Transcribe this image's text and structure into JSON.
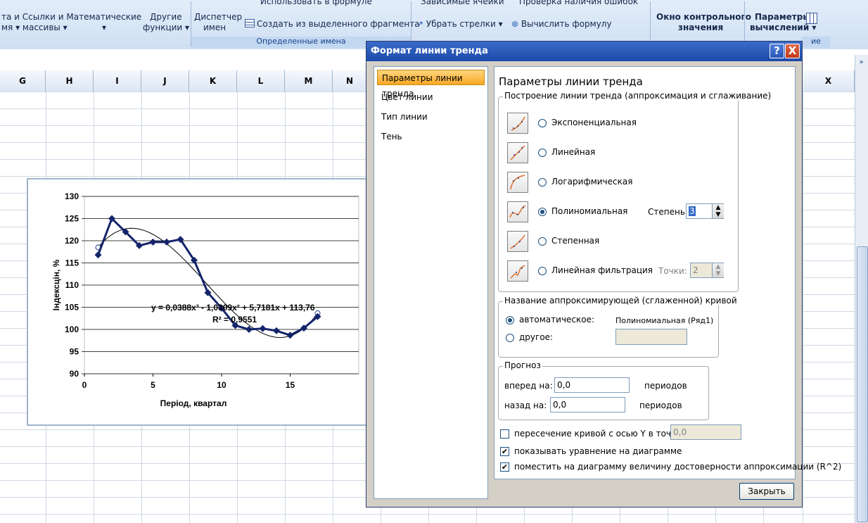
{
  "ribbon": {
    "items": {
      "r1": "та и  Ссылки и  Математические",
      "r1b": "мя ▾ массивы ▾",
      "r1c": "▾",
      "other": "Другие",
      "other2": "функции ▾",
      "dispatcher": "Диспетчер",
      "dispatcher2": "имен",
      "use_in_formula": "Использовать в формуле",
      "create_from_sel": "Создать из выделенного фрагмента",
      "dependent": "Зависимые ячейки",
      "check_errors": "Проверка наличия ошибок",
      "remove_arrows": "Убрать стрелки ▾",
      "eval_formula": "Вычислить формулу",
      "watch_window": "Окно контрольного",
      "watch_window2": "значения",
      "calc_params": "Параметры",
      "calc_params2": "вычислений ▾",
      "group_defined": "Определенные имена",
      "group_calc": "ие"
    }
  },
  "grid": {
    "columns": [
      "G",
      "H",
      "I",
      "J",
      "K",
      "L",
      "M",
      "N",
      "X"
    ]
  },
  "chart_data": {
    "type": "line",
    "title": "",
    "xlabel": "Період, квартал",
    "ylabel": "Індексцін, %",
    "xlim": [
      0,
      20
    ],
    "ylim": [
      90,
      130
    ],
    "xticks": [
      "0",
      "5",
      "10",
      "15"
    ],
    "yticks": [
      "90",
      "95",
      "100",
      "105",
      "110",
      "115",
      "120",
      "125",
      "130"
    ],
    "series": [
      {
        "x": [
          1,
          2,
          3,
          4,
          5,
          6,
          7,
          8,
          9,
          10,
          11,
          12,
          13,
          14,
          15,
          16,
          17
        ],
        "y": [
          116.8,
          125.0,
          122.0,
          118.9,
          119.7,
          119.7,
          120.3,
          115.6,
          108.3,
          104.8,
          100.9,
          100.0,
          100.2,
          99.7,
          98.7,
          100.3,
          102.9
        ]
      }
    ],
    "trendline": {
      "type": "polynomial",
      "order": 3,
      "coefficients": [
        0.0388,
        -1.0309,
        5.7181,
        113.76
      ]
    },
    "equation": "y = 0,0388x³ - 1,0309x² + 5,7181x + 113,76",
    "r_squared": "R² = 0,9551"
  },
  "dialog": {
    "title": "Формат линии тренда",
    "help": "?",
    "close_x": "X",
    "nav": [
      "Параметры линии тренда",
      "Цвет линии",
      "Тип линии",
      "Тень"
    ],
    "heading": "Параметры линии тренда",
    "group_build": "Построение линии тренда (аппроксимация и сглаживание)",
    "types": [
      "Экспоненциальная",
      "Линейная",
      "Логарифмическая",
      "Полиномиальная",
      "Степенная",
      "Линейная фильтрация"
    ],
    "degree_label": "Степень:",
    "degree_value": "3",
    "points_label": "Точки:",
    "points_value": "2",
    "group_name": "Название аппроксимирующей (сглаженной) кривой",
    "auto_label": "автоматическое:",
    "auto_value": "Полиномиальная (Ряд1)",
    "other_label": "другое:",
    "group_forecast": "Прогноз",
    "forward_label": "вперед на:",
    "forward_value": "0,0",
    "back_label": "назад на:",
    "back_value": "0,0",
    "periods": "периодов",
    "intercept_label": "пересечение кривой с осью Y в точке:",
    "intercept_value": "0,0",
    "show_equation": "показывать уравнение на диаграмме",
    "show_r2": "поместить на диаграмму величину достоверности аппроксимации (R^2)",
    "close_button": "Закрыть"
  }
}
